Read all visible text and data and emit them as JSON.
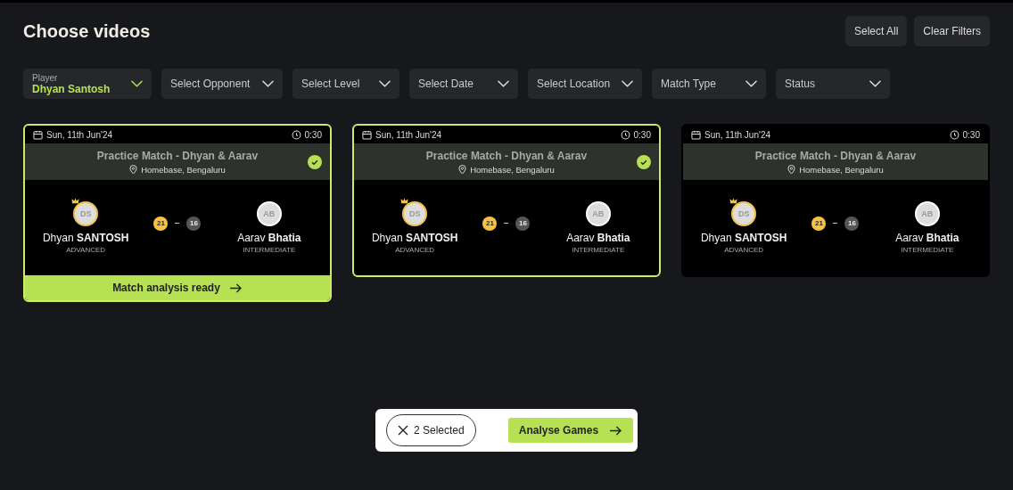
{
  "title": "Choose videos",
  "actions": [
    "Select All",
    "Clear Filters"
  ],
  "filters": [
    {
      "label": "Player",
      "value": "Dhyan Santosh"
    },
    {
      "placeholder": "Select Opponent"
    },
    {
      "placeholder": "Select Level"
    },
    {
      "placeholder": "Select Date"
    },
    {
      "placeholder": "Select Location"
    },
    {
      "placeholder": "Match Type"
    },
    {
      "placeholder": "Status"
    }
  ],
  "cards": [
    {
      "date": "Sun, 11th Jun'24",
      "duration": "0:30",
      "title": "Practice Match - Dhyan & Aarav",
      "location": "Homebase, Bengaluru",
      "selected": true,
      "players": [
        {
          "initials": "DS",
          "name": "Dhyan **SANTOSH**",
          "level": "ADVANCED",
          "winner": true
        },
        {
          "initials": "AB",
          "name": "Aarav **Bhatia**",
          "level": "INTERMEDIATE",
          "winner": false
        }
      ],
      "scores": [
        {
          "value": "21",
          "winner": true
        },
        {
          "value": "16",
          "winner": false
        }
      ],
      "footer": "Match analysis ready"
    },
    {
      "date": "Sun, 11th Jun'24",
      "duration": "0:30",
      "title": "Practice Match - Dhyan & Aarav",
      "location": "Homebase, Bengaluru",
      "selected": true,
      "players": [
        {
          "initials": "DS",
          "name": "Dhyan **SANTOSH**",
          "level": "ADVANCED",
          "winner": true
        },
        {
          "initials": "AB",
          "name": "Aarav **Bhatia**",
          "level": "INTERMEDIATE",
          "winner": false
        }
      ],
      "scores": [
        {
          "value": "21",
          "winner": true
        },
        {
          "value": "16",
          "winner": false
        }
      ]
    },
    {
      "date": "Sun, 11th Jun'24",
      "duration": "0:30",
      "title": "Practice Match - Dhyan & Aarav",
      "location": "Homebase, Bengaluru",
      "selected": false,
      "players": [
        {
          "initials": "DS",
          "name": "Dhyan **SANTOSH**",
          "level": "ADVANCED",
          "winner": true
        },
        {
          "initials": "AB",
          "name": "Aarav **Bhatia**",
          "level": "INTERMEDIATE",
          "winner": false
        }
      ],
      "scores": [
        {
          "value": "21",
          "winner": true
        },
        {
          "value": "16",
          "winner": false
        }
      ]
    }
  ],
  "selection_bar": {
    "count": "2 Selected",
    "action": "Analyse Games"
  }
}
